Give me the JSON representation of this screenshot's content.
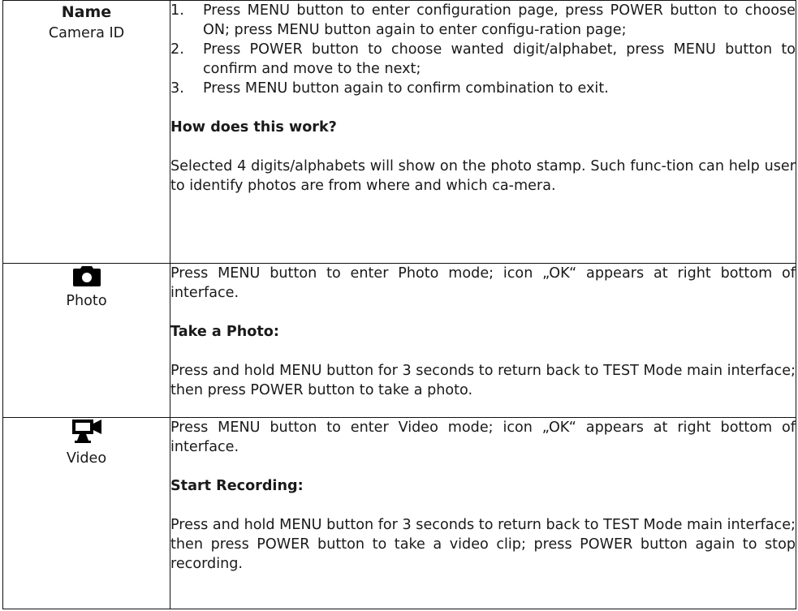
{
  "rows": [
    {
      "heading": "Name",
      "label": "Camera ID",
      "steps": [
        {
          "num": "1.",
          "text": "Press MENU button to enter configuration page, press POWER button to choose ON; press MENU button again to enter configu-ration page;"
        },
        {
          "num": "2.",
          "text": "Press POWER button to choose wanted digit/alphabet, press MENU button to confirm and move to the next;"
        },
        {
          "num": "3.",
          "text": "Press MENU button again to confirm combination to exit."
        }
      ],
      "subheading": "How does this work?",
      "body": "Selected 4 digits/alphabets will show on the photo stamp. Such func-tion can help user to identify photos are from where and which ca-mera."
    },
    {
      "icon": "camera-icon",
      "label": "Photo",
      "intro": "Press MENU button to enter Photo mode; icon „OK“ appears at right bottom of interface.",
      "subheading": "Take a Photo:",
      "body": "Press and hold MENU button for 3 seconds to return back to TEST Mode main interface; then press POWER button to take a photo."
    },
    {
      "icon": "video-camera-icon",
      "label": "Video",
      "intro": "Press MENU button to enter Video mode; icon „OK“ appears at right bottom of interface.",
      "subheading": "Start Recording:",
      "body": "Press and hold MENU button for 3 seconds to return back to TEST Mode main interface; then press POWER button to take a video clip; press POWER button again to stop recording."
    }
  ]
}
